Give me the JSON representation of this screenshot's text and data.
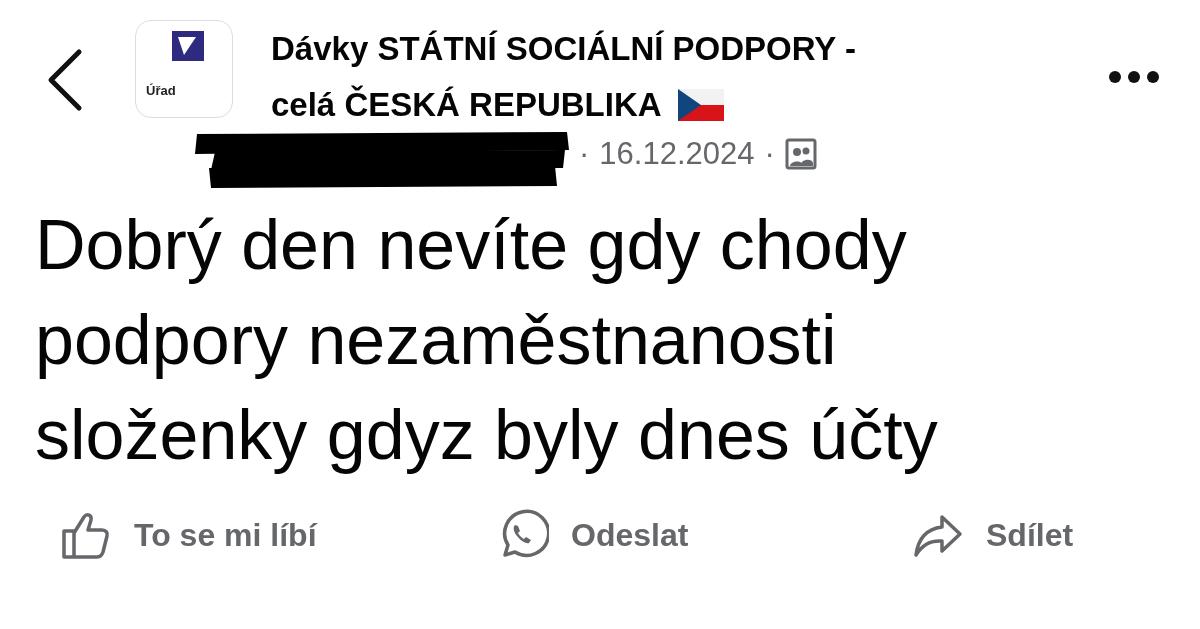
{
  "header": {
    "group_logo_text": "Úřad",
    "group_name_lines": [
      "Dávky STÁTNÍ SOCIÁLNÍ PODPORY -",
      "celá ČESKÁ REPUBLIKA"
    ],
    "date": "16.12.2024",
    "separator": "·"
  },
  "post": {
    "text": "Dobrý den nevíte gdy chody podpory nezaměstnanosti složenky gdyz byly dnes účty"
  },
  "actions": [
    {
      "kind": "like",
      "label": "To se mi líbí"
    },
    {
      "kind": "send",
      "label": "Odeslat"
    },
    {
      "kind": "share",
      "label": "Sdílet"
    }
  ]
}
